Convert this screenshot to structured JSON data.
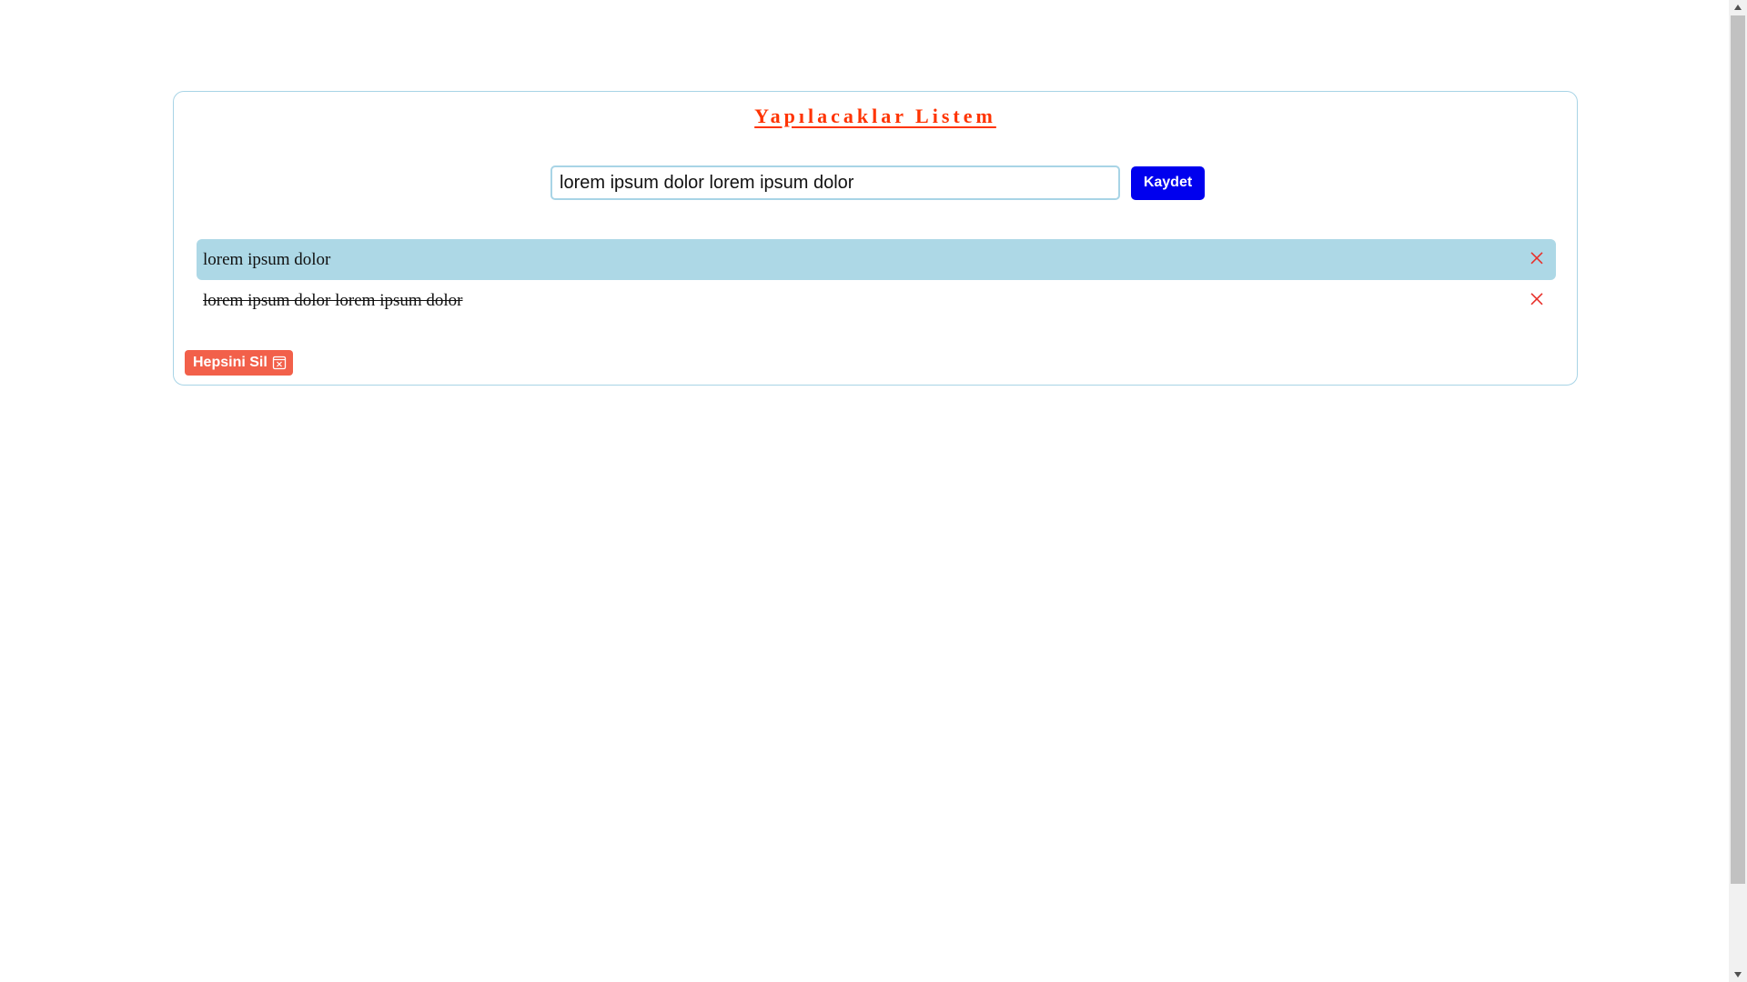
{
  "app": {
    "title": "Yapılacaklar Listem"
  },
  "form": {
    "input_value": "lorem ipsum dolor lorem ipsum dolor",
    "save_label": "Kaydet"
  },
  "tasks": [
    {
      "text": "lorem ipsum dolor",
      "completed": false,
      "highlighted": true,
      "delete_icon": "close-icon"
    },
    {
      "text": "lorem ipsum dolor lorem ipsum dolor",
      "completed": true,
      "highlighted": false,
      "delete_icon": "close-icon"
    }
  ],
  "clear_all": {
    "label": "Hepsini Sil",
    "icon": "trash-box-icon"
  },
  "colors": {
    "title": "#ff3300",
    "save_button": "#0000ee",
    "highlight_row": "#add8e6",
    "delete_icon": "#e8302a",
    "clear_button": "#f2604a",
    "card_border": "#a8d4e6"
  }
}
